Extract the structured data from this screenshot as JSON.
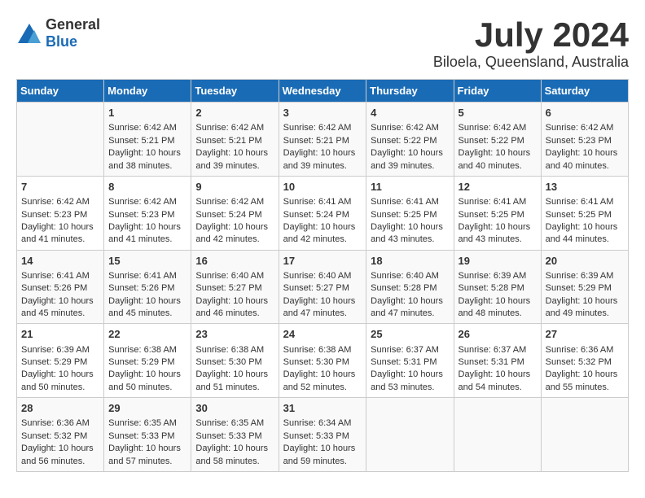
{
  "header": {
    "logo_general": "General",
    "logo_blue": "Blue",
    "month": "July 2024",
    "location": "Biloela, Queensland, Australia"
  },
  "weekdays": [
    "Sunday",
    "Monday",
    "Tuesday",
    "Wednesday",
    "Thursday",
    "Friday",
    "Saturday"
  ],
  "weeks": [
    [
      {
        "day": "",
        "content": ""
      },
      {
        "day": "1",
        "content": "Sunrise: 6:42 AM\nSunset: 5:21 PM\nDaylight: 10 hours\nand 38 minutes."
      },
      {
        "day": "2",
        "content": "Sunrise: 6:42 AM\nSunset: 5:21 PM\nDaylight: 10 hours\nand 39 minutes."
      },
      {
        "day": "3",
        "content": "Sunrise: 6:42 AM\nSunset: 5:21 PM\nDaylight: 10 hours\nand 39 minutes."
      },
      {
        "day": "4",
        "content": "Sunrise: 6:42 AM\nSunset: 5:22 PM\nDaylight: 10 hours\nand 39 minutes."
      },
      {
        "day": "5",
        "content": "Sunrise: 6:42 AM\nSunset: 5:22 PM\nDaylight: 10 hours\nand 40 minutes."
      },
      {
        "day": "6",
        "content": "Sunrise: 6:42 AM\nSunset: 5:23 PM\nDaylight: 10 hours\nand 40 minutes."
      }
    ],
    [
      {
        "day": "7",
        "content": "Sunrise: 6:42 AM\nSunset: 5:23 PM\nDaylight: 10 hours\nand 41 minutes."
      },
      {
        "day": "8",
        "content": "Sunrise: 6:42 AM\nSunset: 5:23 PM\nDaylight: 10 hours\nand 41 minutes."
      },
      {
        "day": "9",
        "content": "Sunrise: 6:42 AM\nSunset: 5:24 PM\nDaylight: 10 hours\nand 42 minutes."
      },
      {
        "day": "10",
        "content": "Sunrise: 6:41 AM\nSunset: 5:24 PM\nDaylight: 10 hours\nand 42 minutes."
      },
      {
        "day": "11",
        "content": "Sunrise: 6:41 AM\nSunset: 5:25 PM\nDaylight: 10 hours\nand 43 minutes."
      },
      {
        "day": "12",
        "content": "Sunrise: 6:41 AM\nSunset: 5:25 PM\nDaylight: 10 hours\nand 43 minutes."
      },
      {
        "day": "13",
        "content": "Sunrise: 6:41 AM\nSunset: 5:25 PM\nDaylight: 10 hours\nand 44 minutes."
      }
    ],
    [
      {
        "day": "14",
        "content": "Sunrise: 6:41 AM\nSunset: 5:26 PM\nDaylight: 10 hours\nand 45 minutes."
      },
      {
        "day": "15",
        "content": "Sunrise: 6:41 AM\nSunset: 5:26 PM\nDaylight: 10 hours\nand 45 minutes."
      },
      {
        "day": "16",
        "content": "Sunrise: 6:40 AM\nSunset: 5:27 PM\nDaylight: 10 hours\nand 46 minutes."
      },
      {
        "day": "17",
        "content": "Sunrise: 6:40 AM\nSunset: 5:27 PM\nDaylight: 10 hours\nand 47 minutes."
      },
      {
        "day": "18",
        "content": "Sunrise: 6:40 AM\nSunset: 5:28 PM\nDaylight: 10 hours\nand 47 minutes."
      },
      {
        "day": "19",
        "content": "Sunrise: 6:39 AM\nSunset: 5:28 PM\nDaylight: 10 hours\nand 48 minutes."
      },
      {
        "day": "20",
        "content": "Sunrise: 6:39 AM\nSunset: 5:29 PM\nDaylight: 10 hours\nand 49 minutes."
      }
    ],
    [
      {
        "day": "21",
        "content": "Sunrise: 6:39 AM\nSunset: 5:29 PM\nDaylight: 10 hours\nand 50 minutes."
      },
      {
        "day": "22",
        "content": "Sunrise: 6:38 AM\nSunset: 5:29 PM\nDaylight: 10 hours\nand 50 minutes."
      },
      {
        "day": "23",
        "content": "Sunrise: 6:38 AM\nSunset: 5:30 PM\nDaylight: 10 hours\nand 51 minutes."
      },
      {
        "day": "24",
        "content": "Sunrise: 6:38 AM\nSunset: 5:30 PM\nDaylight: 10 hours\nand 52 minutes."
      },
      {
        "day": "25",
        "content": "Sunrise: 6:37 AM\nSunset: 5:31 PM\nDaylight: 10 hours\nand 53 minutes."
      },
      {
        "day": "26",
        "content": "Sunrise: 6:37 AM\nSunset: 5:31 PM\nDaylight: 10 hours\nand 54 minutes."
      },
      {
        "day": "27",
        "content": "Sunrise: 6:36 AM\nSunset: 5:32 PM\nDaylight: 10 hours\nand 55 minutes."
      }
    ],
    [
      {
        "day": "28",
        "content": "Sunrise: 6:36 AM\nSunset: 5:32 PM\nDaylight: 10 hours\nand 56 minutes."
      },
      {
        "day": "29",
        "content": "Sunrise: 6:35 AM\nSunset: 5:33 PM\nDaylight: 10 hours\nand 57 minutes."
      },
      {
        "day": "30",
        "content": "Sunrise: 6:35 AM\nSunset: 5:33 PM\nDaylight: 10 hours\nand 58 minutes."
      },
      {
        "day": "31",
        "content": "Sunrise: 6:34 AM\nSunset: 5:33 PM\nDaylight: 10 hours\nand 59 minutes."
      },
      {
        "day": "",
        "content": ""
      },
      {
        "day": "",
        "content": ""
      },
      {
        "day": "",
        "content": ""
      }
    ]
  ]
}
